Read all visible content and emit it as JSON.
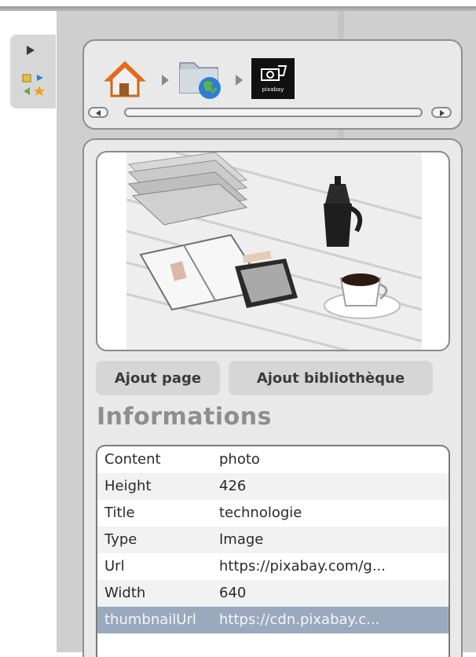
{
  "sidebar": {
    "toggle_icon": "play-arrow-icon",
    "widget_icon": "mini-toolbar-icon"
  },
  "breadcrumb": {
    "items": [
      {
        "name": "home",
        "icon": "home-icon"
      },
      {
        "name": "web-folder",
        "icon": "globe-folder-icon"
      },
      {
        "name": "pixabay",
        "icon": "pixabay-logo-icon",
        "label": "pixabay"
      }
    ],
    "scroll_left_icon": "scroll-left-icon",
    "scroll_right_icon": "scroll-right-icon"
  },
  "preview": {
    "icon": "image-preview"
  },
  "actions": {
    "add_page": "Ajout page",
    "add_library": "Ajout bibliothèque"
  },
  "info": {
    "heading": "Informations",
    "rows": [
      {
        "key": "Content",
        "value": "photo"
      },
      {
        "key": "Height",
        "value": "426"
      },
      {
        "key": "Title",
        "value": "technologie"
      },
      {
        "key": "Type",
        "value": "Image"
      },
      {
        "key": "Url",
        "value": "https://pixabay.com/g..."
      },
      {
        "key": "Width",
        "value": "640"
      },
      {
        "key": "thumbnailUrl",
        "value": "https://cdn.pixabay.c..."
      }
    ],
    "selected_row": "thumbnailUrl"
  },
  "colors": {
    "panel": "#cfcfcf",
    "box": "#e9e9e9",
    "selection": "#9aa9bd",
    "heading": "#8e8e8e"
  }
}
